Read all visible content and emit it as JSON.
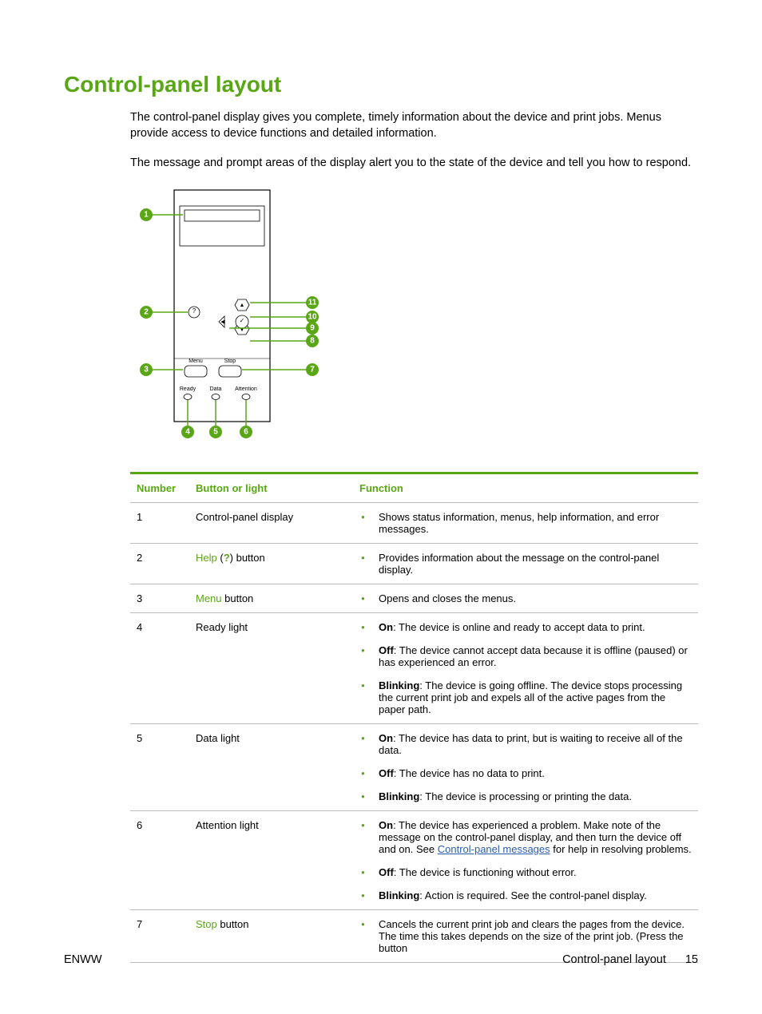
{
  "title": "Control-panel layout",
  "intro": [
    "The control-panel display gives you complete, timely information about the device and print jobs. Menus provide access to device functions and detailed information.",
    "The message and prompt areas of the display alert you to the state of the device and tell you how to respond."
  ],
  "diagram": {
    "callouts_left": {
      "c1": "1",
      "c2": "2",
      "c3": "3"
    },
    "callouts_bottom": {
      "c4": "4",
      "c5": "5",
      "c6": "6"
    },
    "callouts_right": {
      "c7": "7",
      "c8": "8",
      "c9": "9",
      "c10": "10",
      "c11": "11"
    },
    "labels": {
      "menu": "Menu",
      "stop": "Stop",
      "ready": "Ready",
      "data": "Data",
      "attention": "Attention"
    }
  },
  "table": {
    "headers": {
      "number": "Number",
      "button": "Button or light",
      "function": "Function"
    },
    "rows": [
      {
        "num": "1",
        "button_html": [
          {
            "t": "Control-panel display"
          }
        ],
        "fns": [
          [
            {
              "t": "Shows status information, menus, help information, and error messages."
            }
          ]
        ]
      },
      {
        "num": "2",
        "button_html": [
          {
            "t": "Help",
            "c": "green"
          },
          {
            "t": " ("
          },
          {
            "t": "?",
            "c": "green bold"
          },
          {
            "t": ") button"
          }
        ],
        "fns": [
          [
            {
              "t": "Provides information about the message on the control-panel display."
            }
          ]
        ]
      },
      {
        "num": "3",
        "button_html": [
          {
            "t": "Menu",
            "c": "green"
          },
          {
            "t": " button"
          }
        ],
        "fns": [
          [
            {
              "t": "Opens and closes the menus."
            }
          ]
        ]
      },
      {
        "num": "4",
        "button_html": [
          {
            "t": "Ready light"
          }
        ],
        "fns": [
          [
            {
              "t": "On",
              "b": true
            },
            {
              "t": ": The device is online and ready to accept data to print."
            }
          ],
          [
            {
              "t": "Off",
              "b": true
            },
            {
              "t": ": The device cannot accept data because it is offline (paused) or has experienced an error."
            }
          ],
          [
            {
              "t": "Blinking",
              "b": true
            },
            {
              "t": ": The device is going offline. The device stops processing the current print job and expels all of the active pages from the paper path."
            }
          ]
        ]
      },
      {
        "num": "5",
        "button_html": [
          {
            "t": "Data light"
          }
        ],
        "fns": [
          [
            {
              "t": "On",
              "b": true
            },
            {
              "t": ": The device has data to print, but is waiting to receive all of the data."
            }
          ],
          [
            {
              "t": "Off",
              "b": true
            },
            {
              "t": ": The device has no data to print."
            }
          ],
          [
            {
              "t": "Blinking",
              "b": true
            },
            {
              "t": ": The device is processing or printing the data."
            }
          ]
        ]
      },
      {
        "num": "6",
        "button_html": [
          {
            "t": "Attention light"
          }
        ],
        "fns": [
          [
            {
              "t": "On",
              "b": true
            },
            {
              "t": ": The device has experienced a problem. Make note of the message on the control-panel display, and then turn the device off and on. See "
            },
            {
              "t": "Control-panel messages",
              "link": true
            },
            {
              "t": " for help in resolving problems."
            }
          ],
          [
            {
              "t": "Off",
              "b": true
            },
            {
              "t": ": The device is functioning without error."
            }
          ],
          [
            {
              "t": "Blinking",
              "b": true
            },
            {
              "t": ": Action is required. See the control-panel display."
            }
          ]
        ]
      },
      {
        "num": "7",
        "button_html": [
          {
            "t": "Stop",
            "c": "green"
          },
          {
            "t": " button"
          }
        ],
        "fns": [
          [
            {
              "t": "Cancels the current print job and clears the pages from the device. The time this takes depends on the size of the print job. (Press the button"
            }
          ]
        ]
      }
    ]
  },
  "footer": {
    "left": "ENWW",
    "section": "Control-panel layout",
    "page": "15"
  }
}
